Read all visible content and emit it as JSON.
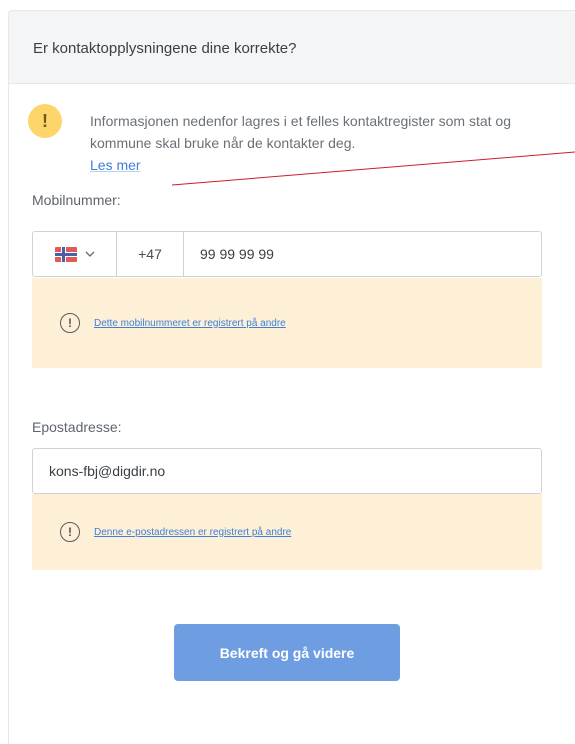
{
  "header": {
    "title": "Er kontaktopplysningene dine korrekte?"
  },
  "info": {
    "icon": "warning-icon",
    "icon_text": "!",
    "text": "Informasjonen nedenfor lagres i et felles kontaktregister som stat og kommune skal bruke når de kontakter deg.",
    "link_label": "Les mer"
  },
  "mobile": {
    "label": "Mobilnummer:",
    "country_flag": "norway-flag-icon",
    "prefix": "+47",
    "value": "99 99 99 99",
    "alert_icon_text": "!",
    "alert_text": "Dette mobilnummeret er registrert på andre"
  },
  "email": {
    "label": "Epostadresse:",
    "value": "kons-fbj@digdir.no",
    "alert_icon_text": "!",
    "alert_text": "Denne e-postadressen er registrert på andre"
  },
  "submit": {
    "label": "Bekreft og gå videre"
  },
  "colors": {
    "warning_circle": "#fdd56b",
    "alert_background": "#fdf0d7",
    "link": "#3f7fd8",
    "button": "#6f9de1",
    "annotation_line": "#c8202a"
  }
}
